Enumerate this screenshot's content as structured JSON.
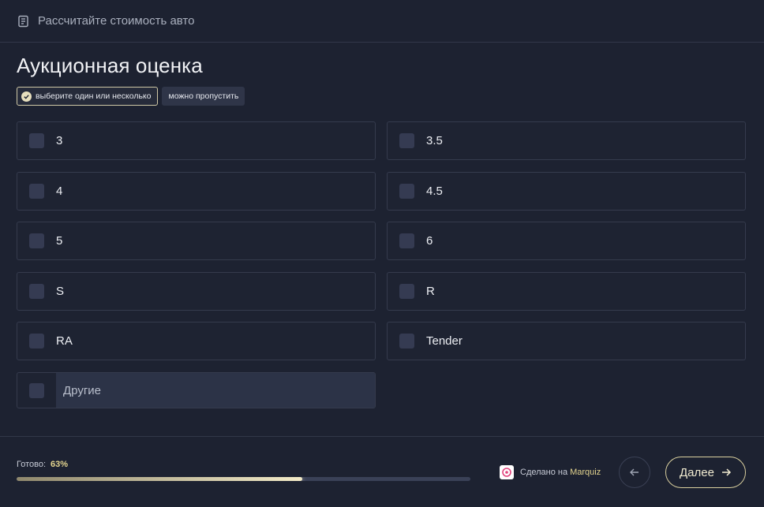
{
  "header": {
    "title": "Рассчитайте стоимость авто",
    "icon": "list-icon"
  },
  "question": {
    "title": "Аукционная оценка",
    "hint_select": "выберите один или несколько",
    "hint_skip": "можно пропустить"
  },
  "options": [
    {
      "label": "3",
      "checked": false
    },
    {
      "label": "3.5",
      "checked": false
    },
    {
      "label": "4",
      "checked": false
    },
    {
      "label": "4.5",
      "checked": false
    },
    {
      "label": "5",
      "checked": false
    },
    {
      "label": "6",
      "checked": false
    },
    {
      "label": "S",
      "checked": false
    },
    {
      "label": "R",
      "checked": false
    },
    {
      "label": "RA",
      "checked": false
    },
    {
      "label": "Tender",
      "checked": false
    }
  ],
  "other": {
    "placeholder": "Другие",
    "value": ""
  },
  "progress": {
    "label": "Готово:",
    "value_text": "63%",
    "percent": 63
  },
  "footer": {
    "made_with": "Сделано на",
    "brand": "Marquiz"
  },
  "buttons": {
    "next_label": "Далее",
    "back_icon": "arrow-left-icon",
    "next_icon": "arrow-right-icon"
  },
  "colors": {
    "accent": "#e3d48f",
    "background": "#1d2231",
    "border": "#353b4d"
  }
}
